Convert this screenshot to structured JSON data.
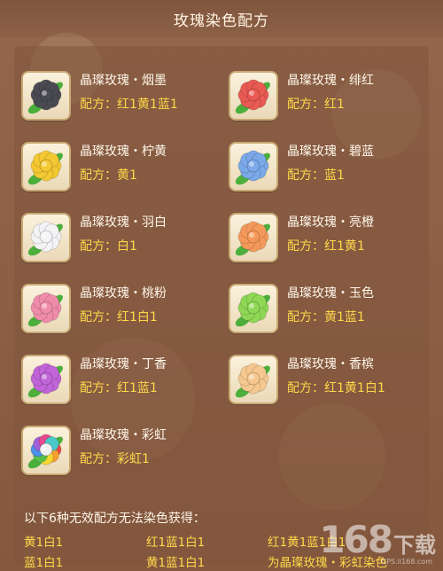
{
  "header": {
    "title": "玫瑰染色配方"
  },
  "recipes": [
    {
      "name": "晶璨玫瑰・烟墨",
      "recipe": "配方：红1黄1蓝1",
      "color": "#4a4a52"
    },
    {
      "name": "晶璨玫瑰・绯红",
      "recipe": "配方：红1",
      "color": "#e85a52"
    },
    {
      "name": "晶璨玫瑰・柠黄",
      "recipe": "配方：黄1",
      "color": "#f4c832"
    },
    {
      "name": "晶璨玫瑰・碧蓝",
      "recipe": "配方：蓝1",
      "color": "#7aa8e8"
    },
    {
      "name": "晶璨玫瑰・羽白",
      "recipe": "配方：白1",
      "color": "#f4f4f6"
    },
    {
      "name": "晶璨玫瑰・亮橙",
      "recipe": "配方：红1黄1",
      "color": "#f5995a"
    },
    {
      "name": "晶璨玫瑰・桃粉",
      "recipe": "配方：红1白1",
      "color": "#f08cab"
    },
    {
      "name": "晶璨玫瑰・玉色",
      "recipe": "配方：黄1蓝1",
      "color": "#8ed855"
    },
    {
      "name": "晶璨玫瑰・丁香",
      "recipe": "配方：红1蓝1",
      "color": "#c064d8"
    },
    {
      "name": "晶璨玫瑰・香槟",
      "recipe": "配方：红1黄1白1",
      "color": "#f6c890"
    },
    {
      "name": "晶璨玫瑰・彩虹",
      "recipe": "配方：彩虹1",
      "color": "rainbow"
    }
  ],
  "invalid": {
    "title": "以下6种无效配方无法染色获得：",
    "items": [
      "黄1白1",
      "红1蓝1白1",
      "红1黄1蓝1白1",
      "蓝1白1",
      "黄1蓝1白1",
      "为晶璨玫瑰・彩虹染色"
    ]
  },
  "watermark": {
    "number": "168",
    "text": "下载",
    "url": "GPS.li168.com"
  }
}
